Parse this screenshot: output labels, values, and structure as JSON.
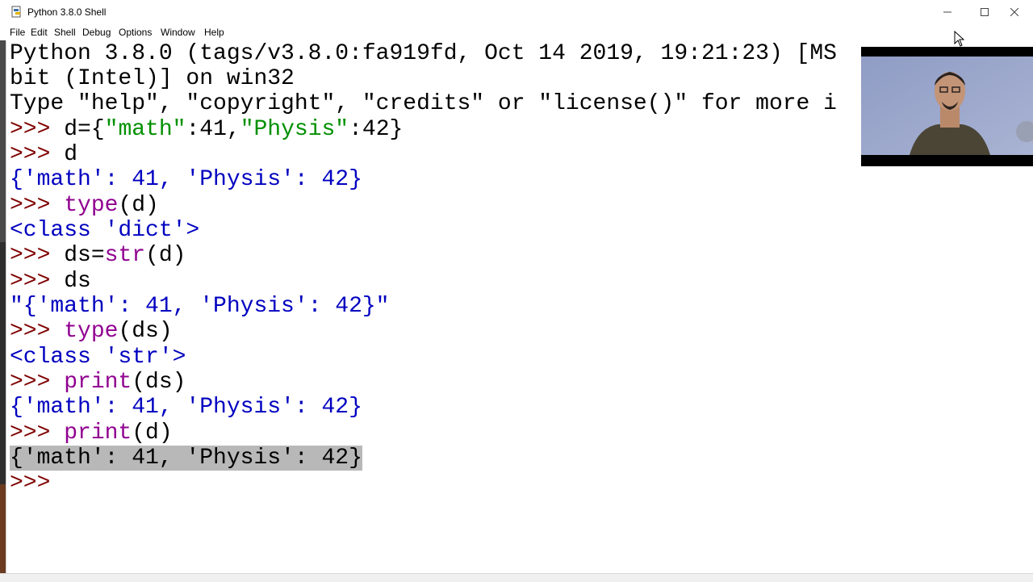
{
  "window": {
    "title": "Python 3.8.0 Shell",
    "minimize_icon": "minimize-icon",
    "maximize_icon": "maximize-icon",
    "close_icon": "close-icon"
  },
  "menu": [
    "File",
    "Edit",
    "Shell",
    "Debug",
    "Options",
    "Window",
    "Help"
  ],
  "shell": {
    "banner1": "Python 3.8.0 (tags/v3.8.0:fa919fd, Oct 14 2019, 19:21:23) [MS",
    "banner2": "bit (Intel)] on win32",
    "banner3": "Type \"help\", \"copyright\", \"credits\" or \"license()\" for more i",
    "prompt": ">>> ",
    "l1_a": "d={",
    "l1_s1": "\"math\"",
    "l1_b": ":41,",
    "l1_s2": "\"Physis\"",
    "l1_c": ":42}",
    "l2": "d",
    "o2": "{'math': 41, 'Physis': 42}",
    "l3_kw": "type",
    "l3_rest": "(d)",
    "o3": "<class 'dict'>",
    "l4_a": "ds=",
    "l4_kw": "str",
    "l4_rest": "(d)",
    "l5": "ds",
    "o5": "\"{'math': 41, 'Physis': 42}\"",
    "l6_kw": "type",
    "l6_rest": "(ds)",
    "o6": "<class 'str'>",
    "l7_kw": "print",
    "l7_rest": "(ds)",
    "o7": "{'math': 41, 'Physis': 42}",
    "l8_kw": "print",
    "l8_rest": "(d)",
    "o8": "{'math': 41, 'Physis': 42}",
    "final_prompt": ">>> "
  },
  "colors": {
    "prompt": "#7f0000",
    "builtin": "#900090",
    "string": "#009000",
    "output": "#0000c0",
    "selection": "#b8b8b8"
  }
}
